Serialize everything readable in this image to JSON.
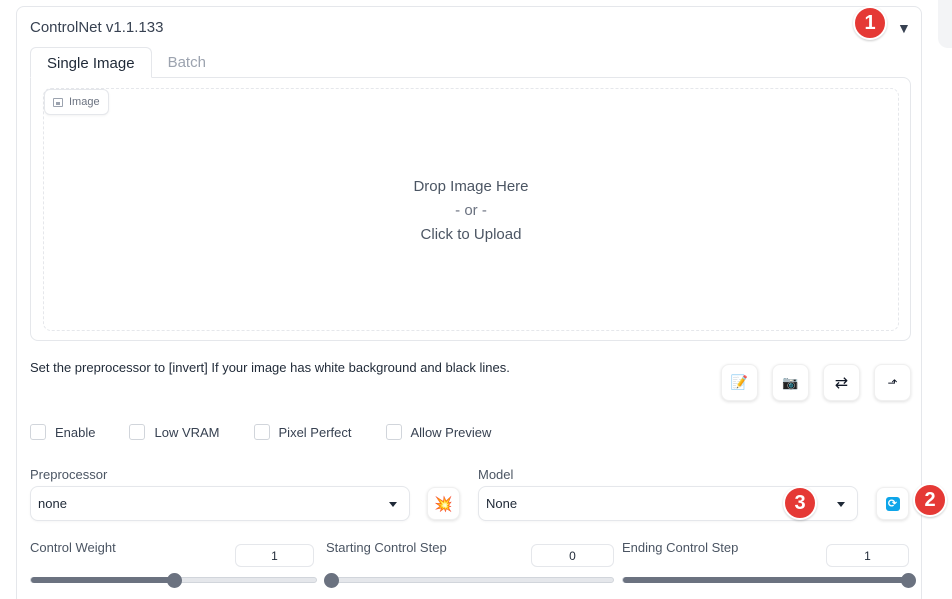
{
  "panel": {
    "title": "ControlNet v1.1.133",
    "collapse_icon": "triangle-down-icon"
  },
  "tabs": [
    {
      "label": "Single Image",
      "active": true
    },
    {
      "label": "Batch",
      "active": false
    }
  ],
  "image_input": {
    "label": "Image",
    "drop_text": "Drop Image Here",
    "or_text": "- or -",
    "upload_text": "Click to Upload"
  },
  "hint": "Set the preprocessor to [invert] If your image has white background and black lines.",
  "tool_buttons": [
    {
      "name": "edit-canvas-icon",
      "glyph": "📝"
    },
    {
      "name": "camera-icon",
      "glyph": "📷"
    },
    {
      "name": "swap-arrows-icon",
      "glyph": "⇄"
    },
    {
      "name": "send-dimensions-icon",
      "glyph": "⬏"
    }
  ],
  "checkboxes": [
    {
      "label": "Enable",
      "checked": false
    },
    {
      "label": "Low VRAM",
      "checked": false
    },
    {
      "label": "Pixel Perfect",
      "checked": false
    },
    {
      "label": "Allow Preview",
      "checked": false
    }
  ],
  "preprocessor": {
    "label": "Preprocessor",
    "value": "none",
    "run_icon": "explosion-icon",
    "run_glyph": "💥"
  },
  "model": {
    "label": "Model",
    "value": "None",
    "refresh_icon": "refresh-icon"
  },
  "sliders": [
    {
      "label": "Control Weight",
      "value": "1",
      "fraction": 0.5
    },
    {
      "label": "Starting Control Step",
      "value": "0",
      "fraction": 0.0
    },
    {
      "label": "Ending Control Step",
      "value": "1",
      "fraction": 1.0
    }
  ],
  "annotations": [
    "1",
    "2",
    "3"
  ],
  "colors": {
    "badge": "#e53935",
    "refresh": "#0ea5e9",
    "slider": "#6b7280"
  }
}
